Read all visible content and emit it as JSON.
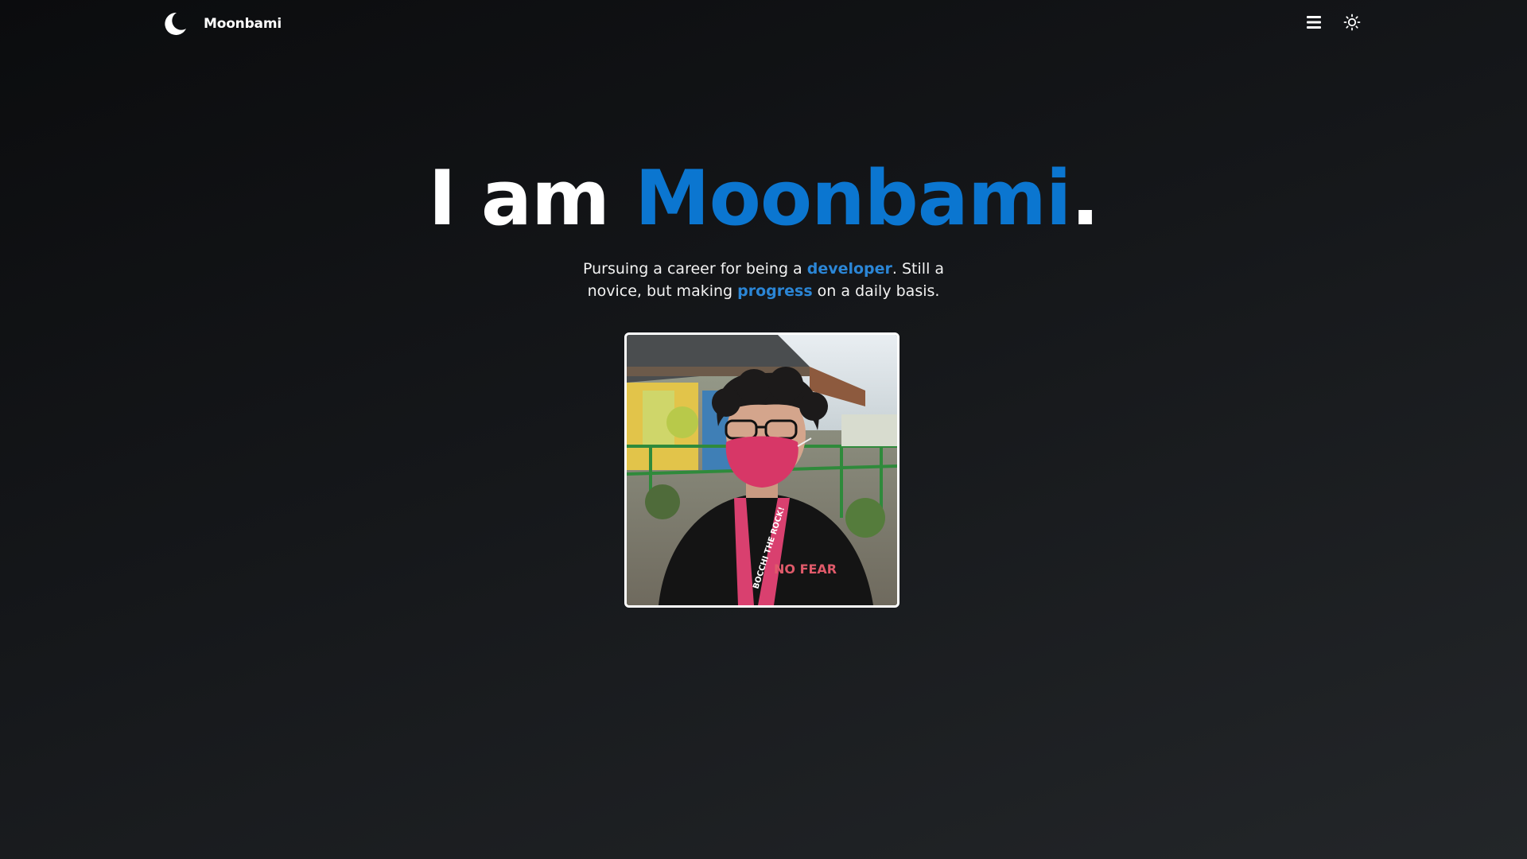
{
  "header": {
    "brand_name": "Moonbami",
    "logo_icon": "crescent-moon-icon",
    "menu_icon": "hamburger-menu-icon",
    "theme_icon": "sun-icon"
  },
  "hero": {
    "title_prefix": "I am ",
    "title_name": "Moonbami",
    "title_suffix": ".",
    "subtitle_part1": "Pursuing a career for being a ",
    "subtitle_link1": "developer",
    "subtitle_part2": ". Still a novice, but making ",
    "subtitle_link2": "progress",
    "subtitle_part3": " on a daily basis."
  },
  "photo": {
    "lanyard_text": "BOCCHI THE ROCK!",
    "shirt_text": "NO FEAR"
  },
  "colors": {
    "accent": "#0b76d0",
    "link": "#2b86d6",
    "background_dark": "#0b0c0e",
    "background_light": "#232629",
    "text": "#ffffff"
  }
}
